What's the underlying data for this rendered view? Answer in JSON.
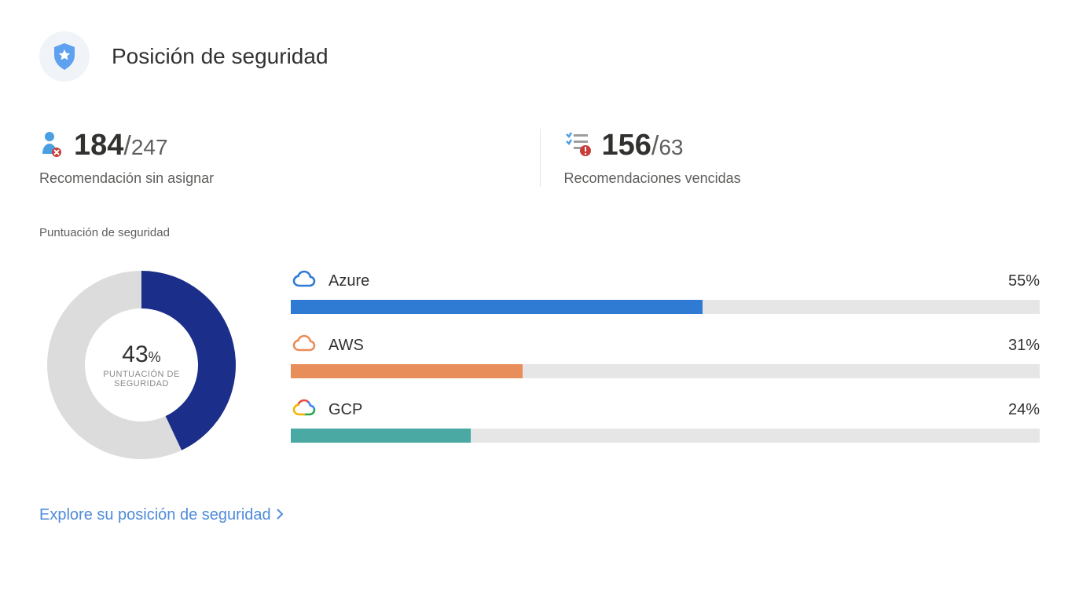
{
  "header": {
    "title": "Posición de seguridad"
  },
  "metrics": {
    "unassigned": {
      "value": "184",
      "total": "247",
      "label": "Recomendación sin asignar"
    },
    "overdue": {
      "value": "156",
      "total": "63",
      "label": "Recomendaciones vencidas"
    }
  },
  "score": {
    "section_label": "Puntuación de seguridad",
    "value": "43",
    "pct_symbol": "%",
    "caption": "PUNTUACIÓN DE SEGURIDAD"
  },
  "providers": [
    {
      "name": "Azure",
      "pct": 55,
      "pct_label": "55%",
      "color": "#2f7ad3",
      "icon": "azure"
    },
    {
      "name": "AWS",
      "pct": 31,
      "pct_label": "31%",
      "color": "#e88e5a",
      "icon": "aws"
    },
    {
      "name": "GCP",
      "pct": 24,
      "pct_label": "24%",
      "color": "#4aa9a3",
      "icon": "gcp"
    }
  ],
  "explore": {
    "label": "Explore su posición de seguridad"
  },
  "colors": {
    "donut_fill": "#1a2e8a",
    "donut_track": "#dcdcdc"
  },
  "chart_data": {
    "type": "bar",
    "title": "Puntuación de seguridad",
    "overall_score_pct": 43,
    "categories": [
      "Azure",
      "AWS",
      "GCP"
    ],
    "values": [
      55,
      31,
      24
    ],
    "xlabel": "",
    "ylabel": "%",
    "ylim": [
      0,
      100
    ]
  }
}
